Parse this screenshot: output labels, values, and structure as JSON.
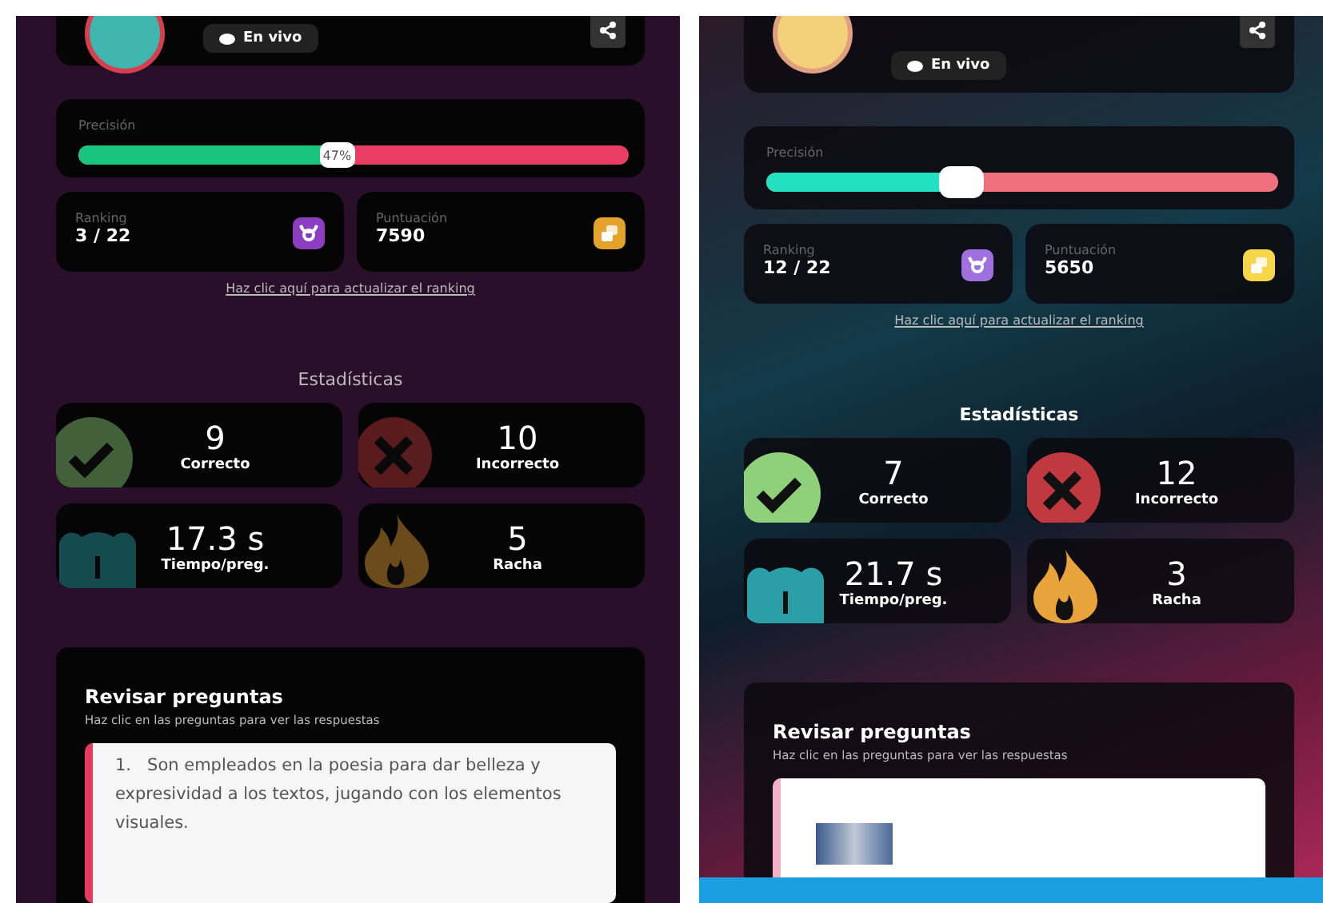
{
  "panels": [
    {
      "kind": "plain",
      "status": "En vivo",
      "precision": {
        "label": "Precisión",
        "level": 0.47,
        "reading": "47%"
      },
      "ranking": {
        "label": "Ranking",
        "value": "3 / 22"
      },
      "score": {
        "label": "Puntuación",
        "value": "7590"
      },
      "refresh_link": "Haz clic aquí para actualizar el ranking",
      "stats_title": "Estadísticas",
      "stats": [
        {
          "kind": "correct",
          "value": "9",
          "label": "Correcto"
        },
        {
          "kind": "incorrect",
          "value": "10",
          "label": "Incorrecto"
        },
        {
          "kind": "time",
          "value": "17.3 s",
          "label": "Tiempo/preg."
        },
        {
          "kind": "streak",
          "value": "5",
          "label": "Racha"
        }
      ],
      "review": {
        "title": "Revisar preguntas",
        "hint": "Haz clic en las preguntas para ver las respuestas",
        "question": {
          "kind": "text",
          "number": "1.",
          "text": "Son empleados en la poesia para dar belleza y expresividad a los textos, jugando con los elementos visuales."
        }
      }
    },
    {
      "kind": "artwork",
      "status": "En vivo",
      "precision": {
        "label": "Precisión",
        "level": 0.38
      },
      "ranking": {
        "label": "Ranking",
        "value": "12 / 22"
      },
      "score": {
        "label": "Puntuación",
        "value": "5650"
      },
      "refresh_link": "Haz clic aquí para actualizar el ranking",
      "stats_title": "Estadísticas",
      "stats": [
        {
          "kind": "correct",
          "value": "7",
          "label": "Correcto"
        },
        {
          "kind": "incorrect",
          "value": "12",
          "label": "Incorrecto"
        },
        {
          "kind": "time",
          "value": "21.7 s",
          "label": "Tiempo/preg."
        },
        {
          "kind": "streak",
          "value": "3",
          "label": "Racha"
        }
      ],
      "review": {
        "title": "Revisar preguntas",
        "hint": "Haz clic en las preguntas para ver las respuestas",
        "question": {
          "kind": "image"
        }
      }
    }
  ]
}
